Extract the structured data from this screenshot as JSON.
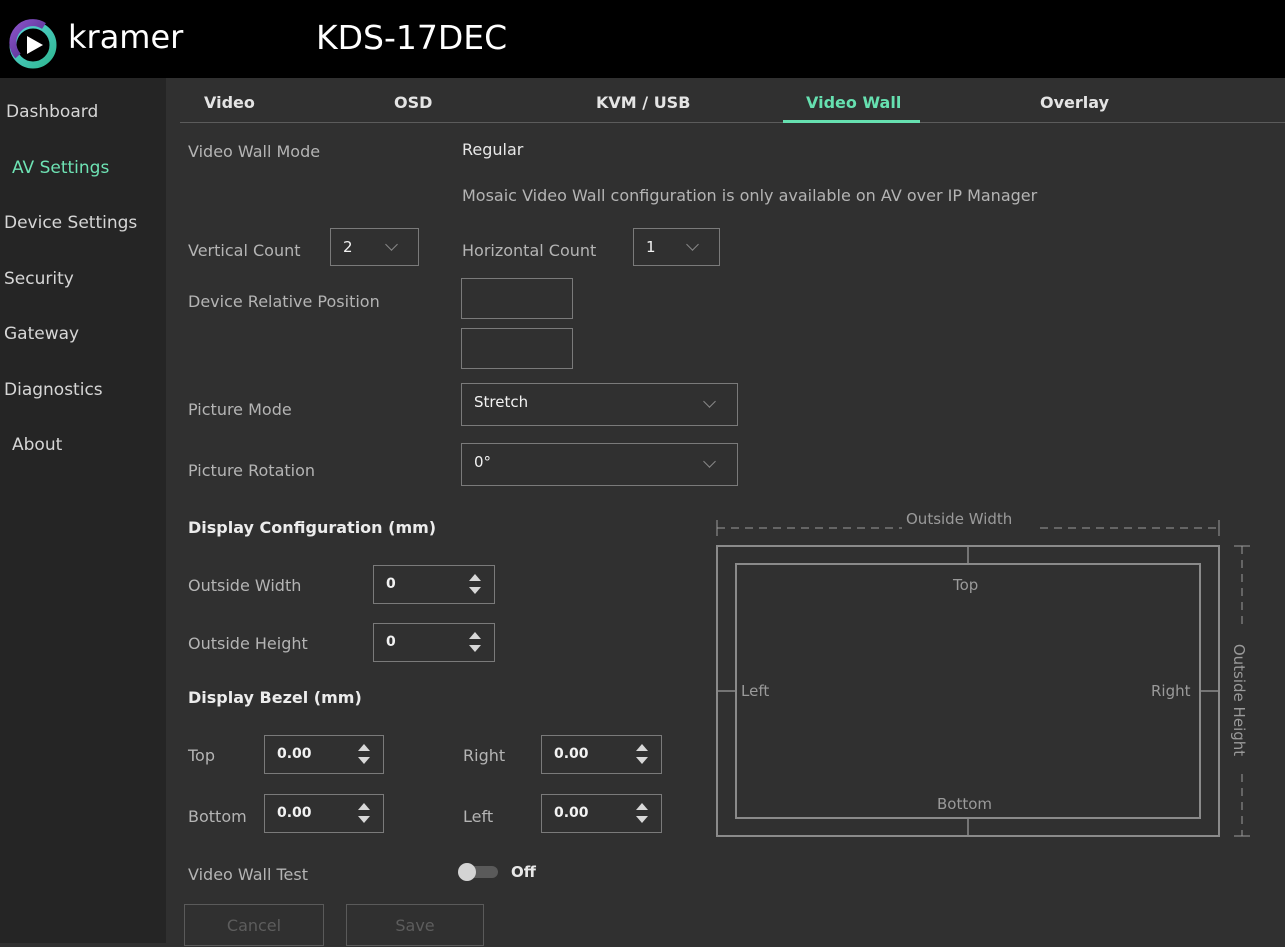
{
  "header": {
    "brand": "kramer",
    "model": "KDS-17DEC"
  },
  "sidebar": {
    "items": [
      {
        "label": "Dashboard"
      },
      {
        "label": "AV Settings"
      },
      {
        "label": "Device Settings"
      },
      {
        "label": "Security"
      },
      {
        "label": "Gateway"
      },
      {
        "label": "Diagnostics"
      },
      {
        "label": "About"
      }
    ],
    "active": "AV Settings"
  },
  "tabs": {
    "items": [
      {
        "label": "Video"
      },
      {
        "label": "OSD"
      },
      {
        "label": "KVM / USB"
      },
      {
        "label": "Video Wall"
      },
      {
        "label": "Overlay"
      }
    ],
    "active": "Video Wall"
  },
  "form": {
    "mode_label": "Video Wall Mode",
    "mode_value": "Regular",
    "mosaic_note": "Mosaic Video Wall configuration is only available on AV over IP Manager",
    "vertical_count_label": "Vertical Count",
    "vertical_count_value": "2",
    "horizontal_count_label": "Horizontal Count",
    "horizontal_count_value": "1",
    "relative_position_label": "Device Relative Position",
    "relative_position_row": "",
    "relative_position_col": "",
    "picture_mode_label": "Picture Mode",
    "picture_mode_value": "Stretch",
    "picture_rotation_label": "Picture Rotation",
    "picture_rotation_value": "0°",
    "display_config_title": "Display Configuration (mm)",
    "outside_width_label": "Outside Width",
    "outside_width_value": "0",
    "outside_height_label": "Outside Height",
    "outside_height_value": "0",
    "bezel_title": "Display Bezel (mm)",
    "bezel_top_label": "Top",
    "bezel_top_value": "0.00",
    "bezel_right_label": "Right",
    "bezel_right_value": "0.00",
    "bezel_bottom_label": "Bottom",
    "bezel_bottom_value": "0.00",
    "bezel_left_label": "Left",
    "bezel_left_value": "0.00",
    "test_label": "Video Wall Test",
    "test_state": "Off",
    "cancel_label": "Cancel",
    "save_label": "Save"
  },
  "diagram": {
    "outside_width": "Outside Width",
    "outside_height": "Outside Height",
    "top": "Top",
    "bottom": "Bottom",
    "left": "Left",
    "right": "Right"
  },
  "colors": {
    "accent": "#66e0b0",
    "header_bg": "#000000",
    "sidebar_bg": "#252525",
    "content_bg": "#303030"
  }
}
